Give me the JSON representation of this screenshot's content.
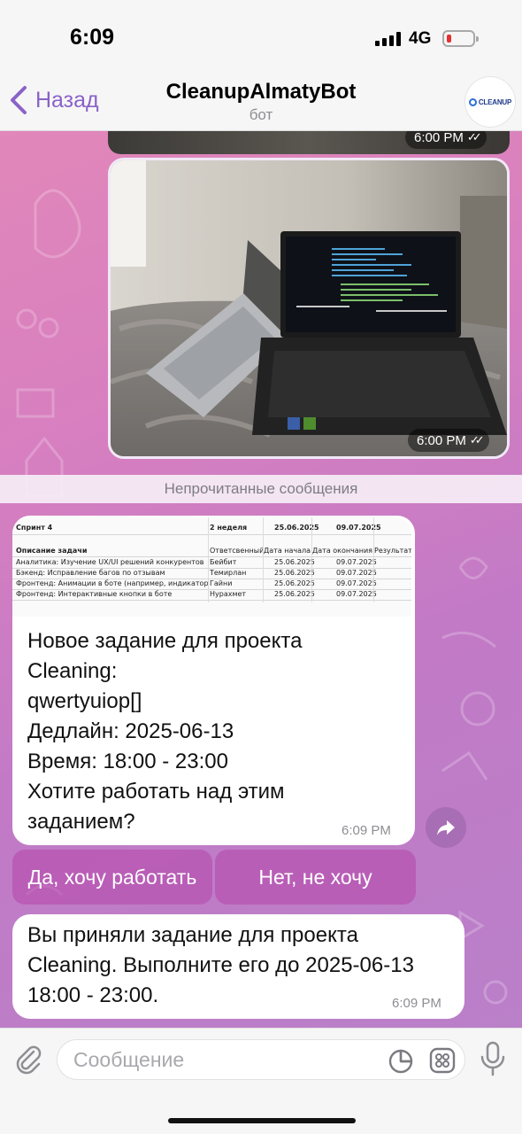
{
  "status_bar": {
    "time": "6:09",
    "network": "4G"
  },
  "header": {
    "back_label": "Назад",
    "title": "CleanupAlmatyBot",
    "subtitle": "бот",
    "avatar_logo_text": "CLEANUP"
  },
  "messages": {
    "photo_top_time": "6:00 PM",
    "photo_time": "6:00 PM",
    "unread_divider": "Непрочитанные сообщения",
    "task": {
      "sheet": {
        "sprint": "Спринт 4",
        "week": "2 неделя",
        "start": "25.06.2025",
        "end": "09.07.2025",
        "headers": [
          "Описание задачи",
          "Ответсвенный",
          "Дата начала",
          "Дата окончания",
          "Результат"
        ],
        "rows": [
          [
            "Аналитика: Изучение UX/UI решений конкурентов",
            "Бейбит",
            "25.06.2025",
            "09.07.2025"
          ],
          [
            "Бэкенд: Исправление багов по отзывам",
            "Темирлан",
            "25.06.2025",
            "09.07.2025"
          ],
          [
            "Фронтенд: Анимации в боте (например, индикатор загр",
            "Гайни",
            "25.06.2025",
            "09.07.2025"
          ],
          [
            "Фронтенд: Интерактивные кнопки в боте",
            "Нурахмет",
            "25.06.2025",
            "09.07.2025"
          ]
        ]
      },
      "lines": [
        "Новое задание для проекта",
        "Cleaning:",
        "qwertyuiop[]",
        "Дедлайн: 2025-06-13",
        "Время: 18:00 - 23:00",
        "Хотите работать над этим",
        "заданием?"
      ],
      "time": "6:09 PM"
    },
    "buttons": {
      "accept": "Да, хочу работать",
      "decline": "Нет, не хочу"
    },
    "accepted": {
      "lines": [
        "Вы приняли задание для проекта",
        "Cleaning. Выполните его до 2025-06-13",
        "18:00 - 23:00."
      ],
      "time": "6:09 PM"
    }
  },
  "input": {
    "placeholder": "Сообщение"
  },
  "colors": {
    "accent": "#8a62c8",
    "button_bg": "#b446aa"
  }
}
